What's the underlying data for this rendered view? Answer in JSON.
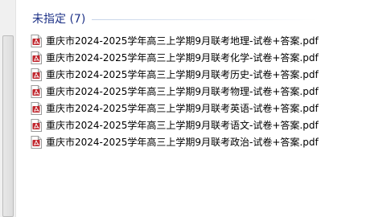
{
  "group": {
    "title": "未指定 (7)"
  },
  "files": [
    {
      "name": "重庆市2024-2025学年高三上学期9月联考地理-试卷+答案.pdf",
      "icon": "pdf-icon"
    },
    {
      "name": "重庆市2024-2025学年高三上学期9月联考化学-试卷+答案.pdf",
      "icon": "pdf-icon"
    },
    {
      "name": "重庆市2024-2025学年高三上学期9月联考历史-试卷+答案.pdf",
      "icon": "pdf-icon"
    },
    {
      "name": "重庆市2024-2025学年高三上学期9月联考物理-试卷+答案.pdf",
      "icon": "pdf-icon"
    },
    {
      "name": "重庆市2024-2025学年高三上学期9月联考英语-试卷+答案.pdf",
      "icon": "pdf-icon"
    },
    {
      "name": "重庆市2024-2025学年高三上学期9月联考语文-试卷+答案.pdf",
      "icon": "pdf-icon"
    },
    {
      "name": "重庆市2024-2025学年高三上学期9月联考政治-试卷+答案.pdf",
      "icon": "pdf-icon"
    }
  ],
  "colors": {
    "group_title": "#1e3287",
    "pdf_icon": "#c0262d"
  }
}
